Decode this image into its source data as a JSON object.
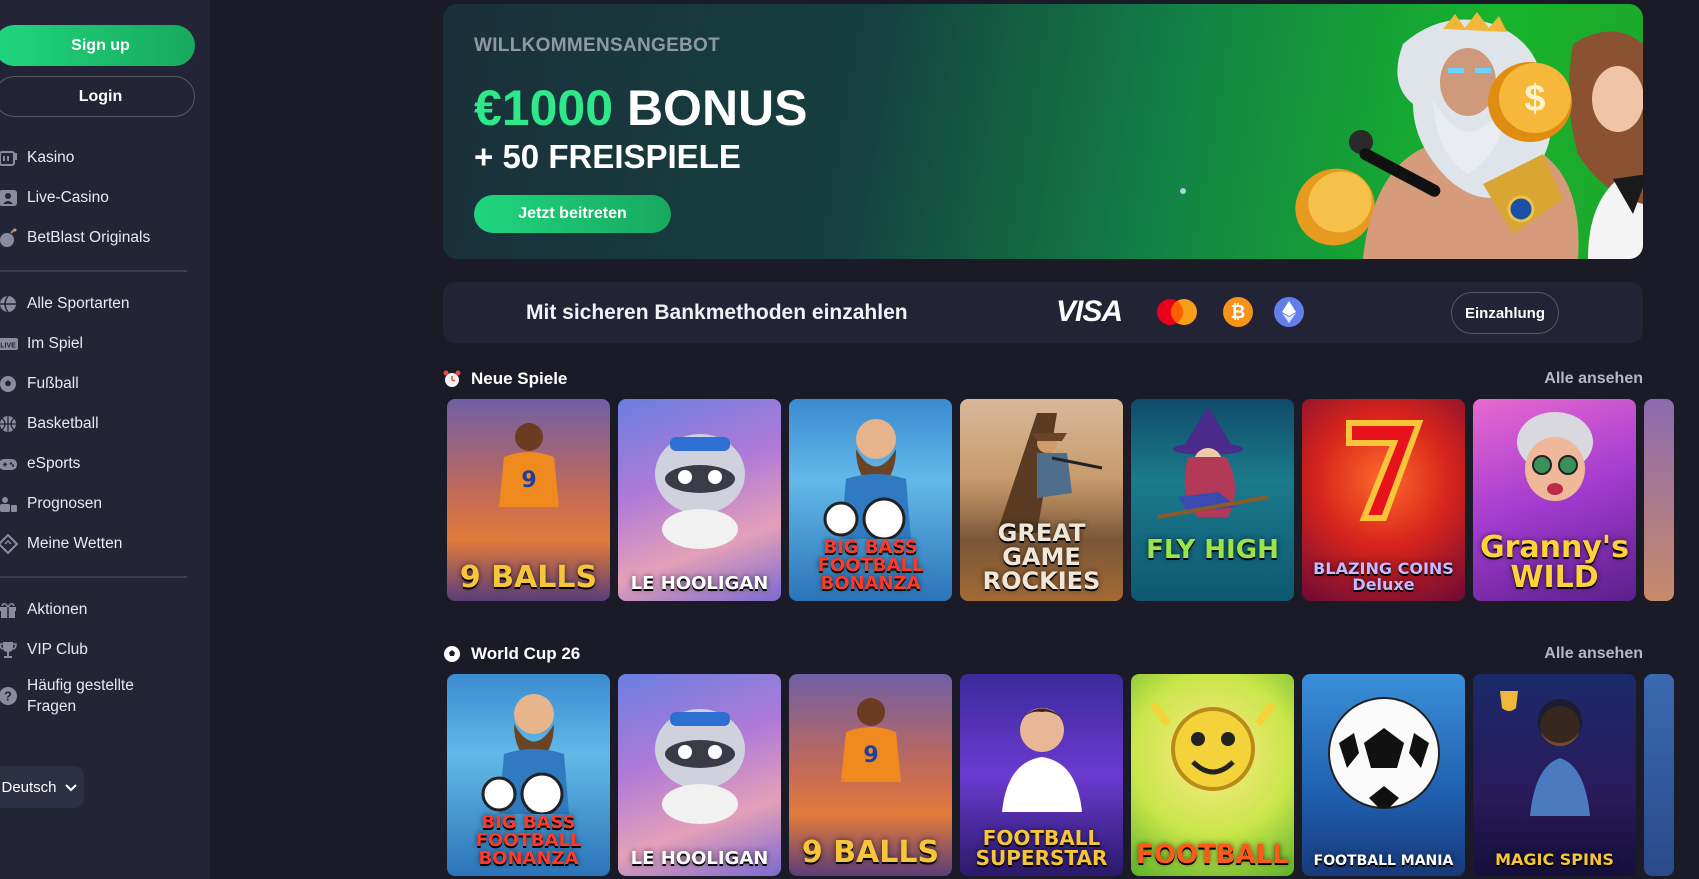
{
  "sidebar": {
    "signup_label": "Sign up",
    "login_label": "Login",
    "group1": [
      {
        "label": "Kasino",
        "icon": "slot-machine-icon"
      },
      {
        "label": "Live-Casino",
        "icon": "live-dealer-icon"
      },
      {
        "label": "BetBlast Originals",
        "icon": "bomb-icon"
      }
    ],
    "group2": [
      {
        "label": "Alle Sportarten",
        "icon": "ball-icon"
      },
      {
        "label": "Im Spiel",
        "icon": "live-icon"
      },
      {
        "label": "Fußball",
        "icon": "soccer-icon"
      },
      {
        "label": "Basketball",
        "icon": "basketball-icon"
      },
      {
        "label": "eSports",
        "icon": "gamepad-icon"
      },
      {
        "label": "Prognosen",
        "icon": "people-icon"
      },
      {
        "label": "Meine Wetten",
        "icon": "ticket-icon"
      }
    ],
    "group3": [
      {
        "label": "Aktionen",
        "icon": "gift-icon"
      },
      {
        "label": "VIP Club",
        "icon": "trophy-icon"
      },
      {
        "label": "Häufig gestellte Fragen",
        "icon": "question-icon"
      }
    ],
    "language": "Deutsch"
  },
  "hero": {
    "kicker": "WILLKOMMENSANGEBOT",
    "amount": "€1000",
    "amount_suffix": " BONUS",
    "sub": "+ 50 FREISPIELE",
    "cta": "Jetzt beitreten"
  },
  "payments": {
    "text": "Mit sicheren Bankmethoden einzahlen",
    "visa": "VISA",
    "btc": "₿",
    "deposit_label": "Einzahlung"
  },
  "sections": [
    {
      "title": "Neue Spiele",
      "view_all": "Alle ansehen",
      "games": [
        "9 BALLS",
        "LE HOOLIGAN",
        "BIG BASS FOOTBALL BONANZA",
        "GREAT GAME ROCKIES",
        "FLY HIGH",
        "BLAZING COINS Deluxe",
        "Granny's WILD"
      ]
    },
    {
      "title": "World Cup 26",
      "view_all": "Alle ansehen",
      "games": [
        "BIG BASS FOOTBALL BONANZA",
        "LE HOOLIGAN",
        "9 BALLS",
        "FOOTBALL SUPERSTAR",
        "FOOTBALL",
        "FOOTBALL MANIA",
        "MAGIC SPINS"
      ]
    }
  ],
  "colors": {
    "accent": "#1fd67e",
    "sidebar_bg": "#232436",
    "page_bg": "#1a1b27"
  }
}
